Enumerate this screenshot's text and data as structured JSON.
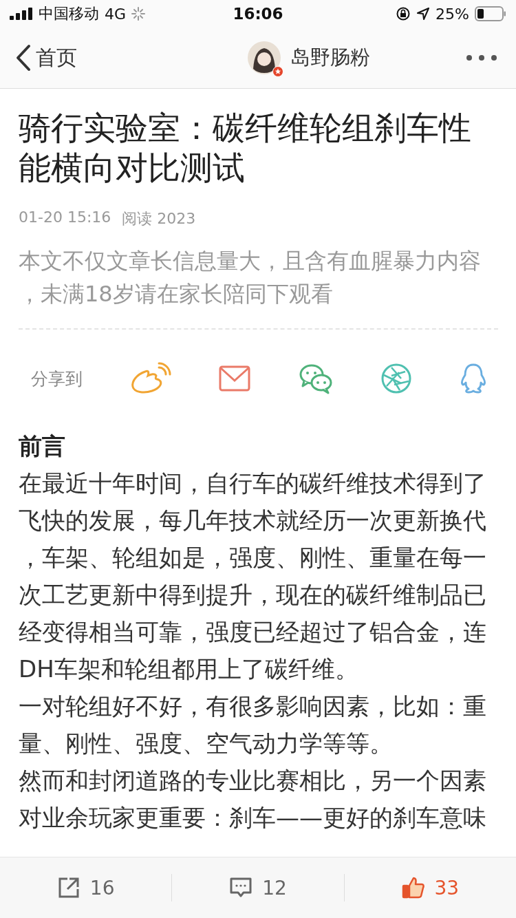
{
  "status_bar": {
    "carrier": "中国移动",
    "network": "4G",
    "time": "16:06",
    "battery": "25%"
  },
  "nav": {
    "back_label": "首页",
    "author": "岛野肠粉"
  },
  "article": {
    "title": "骑行实验室：碳纤维轮组刹车性能横向对比测试",
    "date": "01-20 15:16",
    "reads": "阅读 2023",
    "notice": "本文不仅文章长信息量大，且含有血腥暴力内容，未满18岁请在家长陪同下观看",
    "share": {
      "label": "分享到",
      "targets": [
        {
          "kind": "weibo"
        },
        {
          "kind": "mail"
        },
        {
          "kind": "wechat"
        },
        {
          "kind": "moments"
        },
        {
          "kind": "qq"
        }
      ]
    },
    "heading": "前言",
    "paragraphs": [
      "在最近十年时间，自行车的碳纤维技术得到了飞快的发展，每几年技术就经历一次更新换代，车架、轮组如是，强度、刚性、重量在每一次工艺更新中得到提升，现在的碳纤维制品已经变得相当可靠，强度已经超过了铝合金，连DH车架和轮组都用上了碳纤维。",
      "一对轮组好不好，有很多影响因素，比如：重量、刚性、强度、空气动力学等等。",
      "然而和封闭道路的专业比赛相比，另一个因素对业余玩家更重要：刹车——更好的刹车意味"
    ]
  },
  "toolbar": [
    {
      "kind": "repost",
      "count": "16",
      "active": false
    },
    {
      "kind": "comment",
      "count": "12",
      "active": false
    },
    {
      "kind": "like",
      "count": "33",
      "active": true
    }
  ]
}
